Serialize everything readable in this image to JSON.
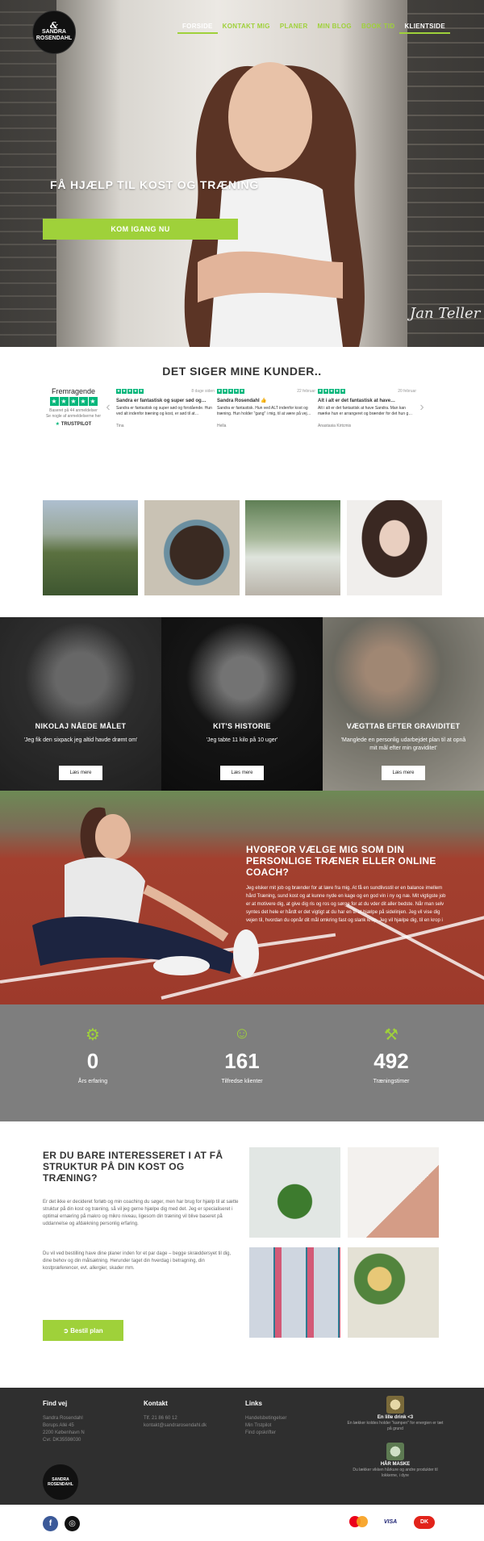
{
  "brand": {
    "logo_line1": "SANDRA",
    "logo_line2": "ROSENDAHL"
  },
  "nav": {
    "items": [
      {
        "label": "FORSIDE"
      },
      {
        "label": "KONTAKT MIG"
      },
      {
        "label": "PLANER"
      },
      {
        "label": "MIN BLOG"
      },
      {
        "label": "BOOK TID"
      },
      {
        "label": "KLIENTSIDE"
      }
    ]
  },
  "hero": {
    "title": "FÅ HJÆLP TIL KOST OG TRÆNING",
    "cta": "KOM IGANG NU",
    "signature": "Jan Teller"
  },
  "reviews": {
    "heading": "DET SIGER MINE KUNDER..",
    "summary": {
      "rating_word": "Fremragende",
      "based_on": "Baseret på 44 anmeldelser",
      "shown": "Se nogle af anmeldelserne her",
      "logo": "TRUSTPILOT"
    },
    "items": [
      {
        "date": "8 dage siden",
        "title": "Sandra er fantastisk og super sød og…",
        "text": "Sandra er fantastisk og super sød og forstående. Hun ved alt indenfor træning og kost, er sød til at…",
        "author": "Tina"
      },
      {
        "date": "22 februar",
        "title": "Sandra Rosendahl 👍",
        "text": "Sandra er fantastisk. Hun ved ALT indenfor kost og træning. Hun holder \"gang\" i mig, til at være på vej…",
        "author": "Hella"
      },
      {
        "date": "20 februar",
        "title": "Alt i alt er det fantastisk at have…",
        "text": "Alt i alt er det fantastisk at have Sandra. Man kan mærke hun er arrangeret og brænder for det hun g…",
        "author": "Anastasia Kirtcmis"
      }
    ]
  },
  "stories": [
    {
      "title": "NIKOLAJ NÅEDE MÅLET",
      "quote": "'Jeg fik den sixpack jeg altid havde drømt om'",
      "button": "Læs mere"
    },
    {
      "title": "KIT'S HISTORIE",
      "quote": "'Jeg tabte 11 kilo på 10 uger'",
      "button": "Læs mere"
    },
    {
      "title": "VÆGTTAB EFTER GRAVIDITET",
      "quote": "'Manglede en personlig udarbejdet plan til at opnå mit mål efter min graviditet'",
      "button": "Læs mere"
    }
  ],
  "why": {
    "heading": "HVORFOR VÆLGE MIG SOM DIN PERSONLIGE TRÆNER ELLER ONLINE COACH?",
    "text": "Jeg elsker mit job og brænder for at lære fra mig. At få en sundlivsstil er en balance imellem hård Træning, sund kost og at kunne nyde en kage og en god vin i ny og næ. Mit vigtigste job er at motivere dig, at give dig ris og ros og sørge for at du vder dit aller bedste. Når man selv syntes det hele er hårdt er det vigtigt at du har en til at hjælpe på sidelinjen. Jeg vil vise dig vejen til, hvordan du opnår dit mål omkring fast og slank krop. Jeg vil hjælpe dig, til en krop i"
  },
  "stats": [
    {
      "icon": "gears-icon",
      "value": "0",
      "label": "Års erfaring"
    },
    {
      "icon": "smiley-icon",
      "value": "161",
      "label": "Tilfredse klienter"
    },
    {
      "icon": "dumbbell-icon",
      "value": "492",
      "label": "Træningstimer"
    }
  ],
  "plan": {
    "heading": "ER DU BARE INTERESSERET I AT FÅ STRUKTUR PÅ DIN KOST OG TRÆNING?",
    "p1": "Er det ikke er decideret forløb og min coaching du søger, men har brug for hjælp til at sætte struktur på din kost og træning, så vil jeg gerne hjælpe dig med det. Jeg er specialiseret i optimal ernæring på makro og mikro niveau, ligesom din træning vil blive baseret på uddannelse og afdækning personlig erfaring.",
    "p2": "Du vil ved bestilling have dine planer inden for et par dage – begge skræddersyet til dig, dine behov og din målsætning. Herunder taget din hverdag i betragning, din kostpræferencer, evt. allergier, skader mm.",
    "button": "➲ Bestil plan"
  },
  "footer": {
    "col1": {
      "title": "Find vej",
      "lines": [
        "Sandra Rosendahl",
        "Borups Allé 45",
        "2200 København N",
        "Cvr. DK35598030"
      ]
    },
    "col2": {
      "title": "Kontakt",
      "lines": [
        "Tlf. 21 86 60 12",
        "kontakt@sandrarosendahl.dk"
      ]
    },
    "col3": {
      "title": "Links",
      "lines": [
        "Handelsbetingelser",
        "Min Trstpilot",
        "Find opskrifter"
      ]
    },
    "promo1": {
      "title": "En lille drink <3",
      "text": "En lækker koldes holder \"kampen\" for energien er tæt på grund"
    },
    "promo2": {
      "title": "HÅR MASKE",
      "text": "Du lækker vikken hårkure og andre produkter til lokkerne, i dyre"
    }
  },
  "payments": {
    "visa": "VISA"
  }
}
